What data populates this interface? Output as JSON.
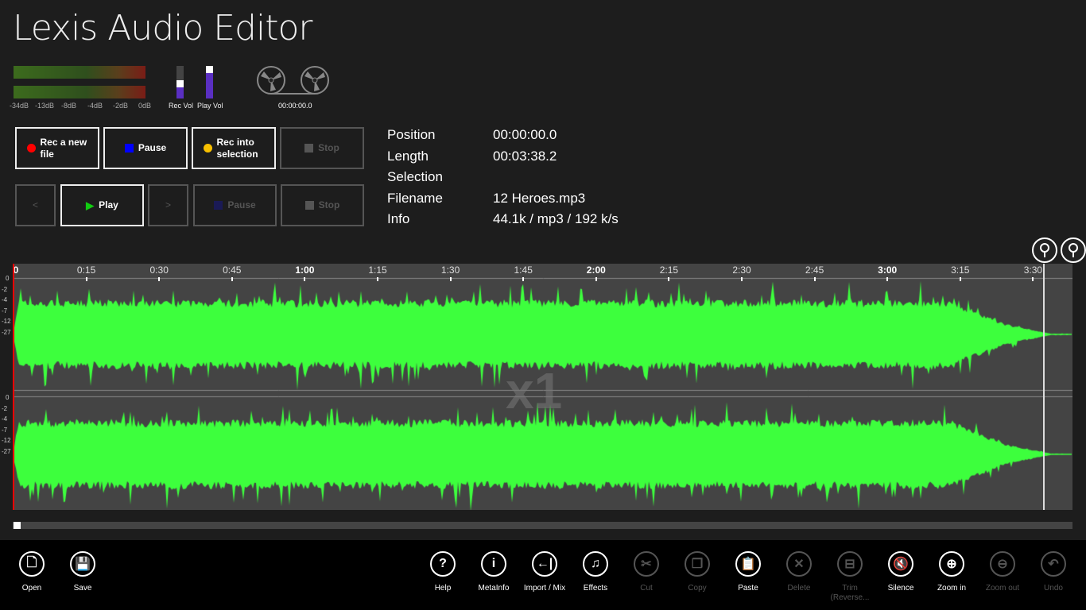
{
  "app": {
    "title": "Lexis Audio Editor"
  },
  "meters": {
    "db_labels": [
      "-34dB",
      "-13dB",
      "-8dB",
      "-4dB",
      "-2dB",
      "0dB"
    ],
    "rec_vol_label": "Rec Vol",
    "play_vol_label": "Play Vol",
    "rec_vol_level": 0.45,
    "play_vol_level": 0.78,
    "counter": "00:00:00.0"
  },
  "record_buttons": {
    "rec_new": "Rec a new file",
    "pause": "Pause",
    "rec_into": "Rec into selection",
    "stop": "Stop"
  },
  "play_buttons": {
    "prev": "<",
    "play": "Play",
    "next": ">",
    "pause": "Pause",
    "stop": "Stop"
  },
  "info": {
    "rows": [
      {
        "label": "Position",
        "value": "00:00:00.0"
      },
      {
        "label": "Length",
        "value": "00:03:38.2"
      },
      {
        "label": "Selection",
        "value": ""
      },
      {
        "label": "Filename",
        "value": "12 Heroes.mp3"
      },
      {
        "label": "Info",
        "value": "44.1k / mp3 / 192 k/s"
      }
    ]
  },
  "timeline": {
    "ticks": [
      "0",
      "0:15",
      "0:30",
      "0:45",
      "1:00",
      "1:15",
      "1:30",
      "1:45",
      "2:00",
      "2:15",
      "2:30",
      "2:45",
      "3:00",
      "3:15",
      "3:30"
    ],
    "db_scale": [
      "0",
      "-2",
      "-4",
      "-7",
      "-12",
      "-27"
    ],
    "zoom_watermark": "x1",
    "waveform_color": "#3dff3d",
    "playhead_color": "#ff0000",
    "scroll_position": 0
  },
  "toolbar": {
    "left": [
      {
        "label": "Open",
        "icon": "open-file-icon",
        "enabled": true
      },
      {
        "label": "Save",
        "icon": "save-icon",
        "enabled": true
      }
    ],
    "right": [
      {
        "label": "Help",
        "icon": "help-icon",
        "glyph": "?",
        "enabled": true
      },
      {
        "label": "MetaInfo",
        "icon": "info-icon",
        "glyph": "i",
        "enabled": true
      },
      {
        "label": "Import / Mix",
        "icon": "import-icon",
        "glyph": "←|",
        "enabled": true
      },
      {
        "label": "Effects",
        "icon": "effects-icon",
        "glyph": "♫",
        "enabled": true
      },
      {
        "label": "Cut",
        "icon": "scissors-icon",
        "glyph": "✂",
        "enabled": false
      },
      {
        "label": "Copy",
        "icon": "copy-icon",
        "glyph": "❐",
        "enabled": false
      },
      {
        "label": "Paste",
        "icon": "paste-icon",
        "glyph": "📋",
        "enabled": true
      },
      {
        "label": "Delete",
        "icon": "delete-icon",
        "glyph": "✕",
        "enabled": false
      },
      {
        "label": "Trim (Reverse...",
        "icon": "trim-icon",
        "glyph": "⊟",
        "enabled": false
      },
      {
        "label": "Silence",
        "icon": "mute-icon",
        "glyph": "🔇",
        "enabled": true
      },
      {
        "label": "Zoom in",
        "icon": "zoom-in-icon",
        "glyph": "⊕",
        "enabled": true
      },
      {
        "label": "Zoom out",
        "icon": "zoom-out-icon",
        "glyph": "⊖",
        "enabled": false
      },
      {
        "label": "Undo",
        "icon": "undo-icon",
        "glyph": "↶",
        "enabled": false
      }
    ]
  }
}
